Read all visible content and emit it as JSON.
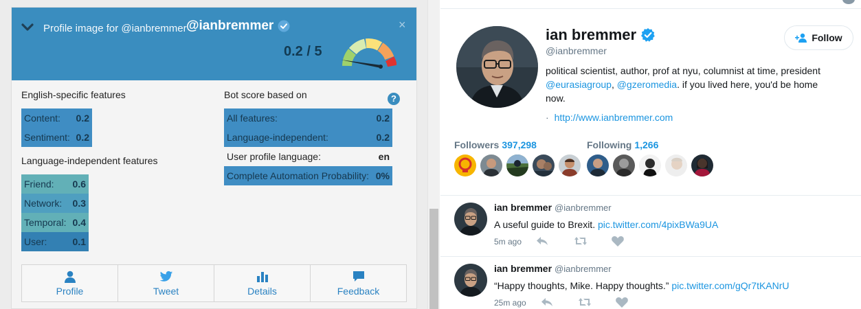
{
  "botometer": {
    "title_prefix": "Profile image for @ianbremmer",
    "handle": "@ianbremmer",
    "score_text": "0.2 / 5",
    "score_value": 0.2,
    "score_max": 5,
    "close_glyph": "×",
    "english_title": "English-specific features",
    "english": [
      {
        "label": "Content:",
        "value": "0.2"
      },
      {
        "label": "Sentiment:",
        "value": "0.2"
      }
    ],
    "lang_indep_title": "Language-independent features",
    "lang_indep": [
      {
        "label": "Friend:",
        "value": "0.6"
      },
      {
        "label": "Network:",
        "value": "0.3"
      },
      {
        "label": "Temporal:",
        "value": "0.4"
      },
      {
        "label": "User:",
        "value": "0.1"
      }
    ],
    "bot_title": "Bot score based on",
    "help_glyph": "?",
    "bot_scores": [
      {
        "label": "All features:",
        "value": "0.2"
      },
      {
        "label": "Language-independent:",
        "value": "0.2"
      },
      {
        "label": "User profile language:",
        "value": "en"
      },
      {
        "label": "Complete Automation Probability:",
        "value": "0%"
      }
    ],
    "tabs": [
      {
        "label": "Profile",
        "icon": "user-icon"
      },
      {
        "label": "Tweet",
        "icon": "twitter-bird-icon"
      },
      {
        "label": "Details",
        "icon": "bar-chart-icon"
      },
      {
        "label": "Feedback",
        "icon": "speech-bubble-icon"
      }
    ],
    "colors": {
      "header": "#3a8dbf",
      "accent": "#2a82c2"
    }
  },
  "twitter": {
    "name": "ian bremmer",
    "handle": "@ianbremmer",
    "follow_label": "Follow",
    "bio_text_1": "political scientist, author, prof at nyu, columnist at time, president",
    "bio_link_1": "@eurasiagroup",
    "bio_comma": ",",
    "bio_link_2": "@gzeromedia",
    "bio_text_2": ". if you lived here, you'd be home now.",
    "url_prefix": "·",
    "url": "http://www.ianbremmer.com",
    "followers_label": "Followers",
    "followers_count": "397,298",
    "following_label": "Following",
    "following_count": "1,266",
    "tweets": [
      {
        "name": "ian bremmer",
        "handle": "@ianbremmer",
        "text": "A useful guide to Brexit.",
        "link": "pic.twitter.com/4pixBWa9UA",
        "time": "5m ago"
      },
      {
        "name": "ian bremmer",
        "handle": "@ianbremmer",
        "text": "“Happy thoughts, Mike. Happy thoughts.”",
        "link": "pic.twitter.com/gQr7tKANrU",
        "time": "25m ago"
      }
    ],
    "colors": {
      "link": "#1b95e0",
      "muted": "#657786"
    }
  }
}
